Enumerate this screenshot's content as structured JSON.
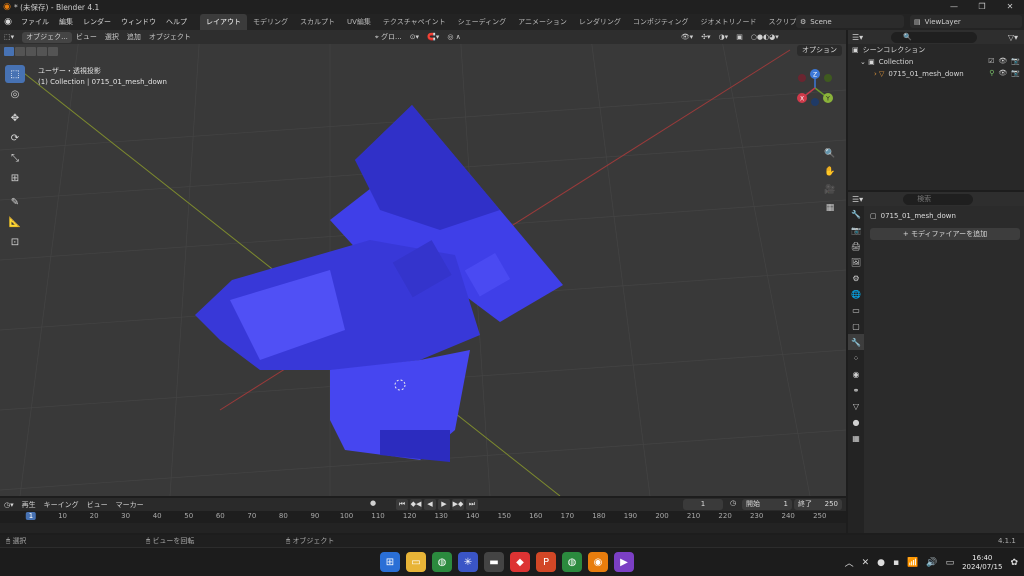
{
  "window": {
    "title": "* (未保存) - Blender 4.1",
    "controls": [
      "—",
      "❐",
      "✕"
    ]
  },
  "menubar": {
    "items": [
      "ファイル",
      "編集",
      "レンダー",
      "ウィンドウ",
      "ヘルプ"
    ],
    "workspaces": [
      "レイアウト",
      "モデリング",
      "スカルプト",
      "UV編集",
      "テクスチャペイント",
      "シェーディング",
      "アニメーション",
      "レンダリング",
      "コンポジティング",
      "ジオメトリノード",
      "スクリプト作成"
    ],
    "active_workspace": 0,
    "scene": "Scene",
    "view_layer": "ViewLayer"
  },
  "viewport": {
    "mode": "オブジェク...",
    "menus": [
      "ビュー",
      "選択",
      "追加",
      "オブジェクト"
    ],
    "transform_orientation": "グロ...",
    "options_label": "オプション",
    "view_name": "ユーザー・透視投影",
    "collection_info": "(1) Collection | 0715_01_mesh_down",
    "gizmo": {
      "x": "X",
      "y": "Y",
      "z": "Z"
    },
    "mesh_color": "#3f3fe8"
  },
  "outliner": {
    "search_placeholder": "",
    "root": "シーンコレクション",
    "collection": "Collection",
    "object": "0715_01_mesh_down"
  },
  "properties": {
    "search_placeholder": "検索",
    "object_name": "0715_01_mesh_down",
    "add_modifier": "モディファイアーを追加"
  },
  "timeline": {
    "menus": [
      "再生",
      "キーイング",
      "ビュー",
      "マーカー"
    ],
    "current_frame": "1",
    "start_label": "開始",
    "start": "1",
    "end_label": "終了",
    "end": "250",
    "ticks": [
      "1",
      "10",
      "20",
      "30",
      "40",
      "50",
      "60",
      "70",
      "80",
      "90",
      "100",
      "110",
      "120",
      "130",
      "140",
      "150",
      "160",
      "170",
      "180",
      "190",
      "200",
      "210",
      "220",
      "230",
      "240",
      "250"
    ]
  },
  "statusbar": {
    "select": "選択",
    "rotate_view": "ビューを回転",
    "object": "オブジェクト",
    "version": "4.1.1"
  },
  "taskbar": {
    "time": "16:40",
    "date": "2024/07/15"
  }
}
